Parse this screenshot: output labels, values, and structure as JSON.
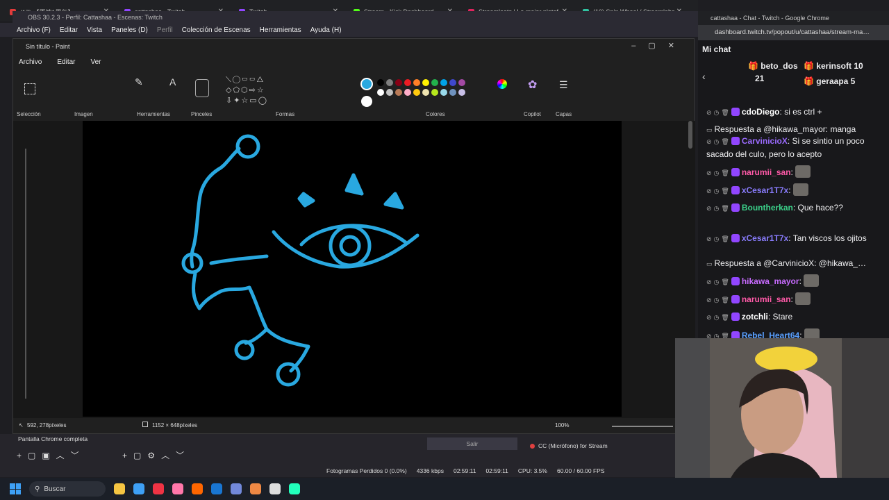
{
  "browser_tabs": [
    {
      "label": "(17) 【原神1周年】…",
      "color": "#e33b3b"
    },
    {
      "label": "cattashaa - Twitch",
      "color": "#9146ff"
    },
    {
      "label": "Twitch",
      "color": "#9146ff"
    },
    {
      "label": "Stream - Kick Dashboard",
      "color": "#53fc18"
    },
    {
      "label": "Streamloots | La mejor plataf…",
      "color": "#e0245e"
    },
    {
      "label": "(10) Spin Wheel / Streamlabs",
      "color": "#31c3a2"
    }
  ],
  "obs": {
    "title": "OBS 30.2.3 - Perfil: Cattashaa - Escenas: Twitch",
    "menu": [
      "Archivo (F)",
      "Editar",
      "Vista",
      "Paneles (D)",
      "Perfil",
      "Colección de Escenas",
      "Herramientas",
      "Ayuda (H)"
    ],
    "scene_source": "Pantalla Chrome completa",
    "audio_source": "CC (Micrófono) for Stream",
    "exit_button": "Salir",
    "status": {
      "dropped_frames": "Fotogramas Perdidos 0 (0.0%)",
      "bitrate": "4336 kbps",
      "stream_time": "02:59:11",
      "rec_time": "02:59:11",
      "cpu": "CPU: 3.5%",
      "fps": "60.00 / 60.00 FPS"
    }
  },
  "paint": {
    "title": "Sin título - Paint",
    "menu": [
      "Archivo",
      "Editar",
      "Ver"
    ],
    "groups": [
      "Selección",
      "Imagen",
      "Herramientas",
      "Pinceles",
      "Formas",
      "Colores",
      "Copilot",
      "Capas"
    ],
    "active_color": "#29a8e0",
    "palette_row1": [
      "#000000",
      "#7f7f7f",
      "#880015",
      "#ed1c24",
      "#ff7f27",
      "#fff200",
      "#22b14c",
      "#00a2e8",
      "#3f48cc",
      "#a349a4"
    ],
    "palette_row2": [
      "#ffffff",
      "#c3c3c3",
      "#b97a57",
      "#ffaec9",
      "#ffc90e",
      "#efe4b0",
      "#b5e61d",
      "#99d9ea",
      "#7092be",
      "#c8bfe7"
    ],
    "cursor_pos": "592, 278píxeles",
    "canvas_size": "1152 × 648píxeles",
    "zoom": "100%"
  },
  "chat": {
    "window_title": "cattashaa - Chat - Twitch - Google Chrome",
    "url": "dashboard.twitch.tv/popout/u/cattashaa/stream-ma…",
    "header": "Mi chat",
    "gifters": [
      {
        "name": "beto_dos",
        "count": "21"
      },
      {
        "name": "kerinsoft",
        "count": "10"
      },
      {
        "name": "geraapa",
        "count": "5"
      }
    ],
    "messages": [
      {
        "user": "cdoDiego",
        "color": "#ffffff",
        "text": "si es ctrl +"
      },
      {
        "reply": "Respuesta a @hikawa_mayor: manga"
      },
      {
        "user": "CarvinicioX",
        "color": "#9b6bff",
        "text": "Si se sintio un poco sacado del culo, pero lo acepto"
      },
      {
        "user": "narumii_san",
        "color": "#ff5aa8",
        "text": ""
      },
      {
        "user": "xCesar1T7x",
        "color": "#8a7dff",
        "text": ""
      },
      {
        "user": "Bountherkan",
        "color": "#3bd18a",
        "text": "Que hace??"
      },
      {
        "user": "xCesar1T7x",
        "color": "#8a7dff",
        "text": "Tan viscos los ojitos"
      },
      {
        "reply": "Respuesta a @CarvinicioX: @hikawa_…"
      },
      {
        "user": "hikawa_mayor",
        "color": "#c86bff",
        "text": ""
      },
      {
        "user": "narumii_san",
        "color": "#ff5aa8",
        "text": ""
      },
      {
        "user": "zotchli",
        "color": "#ffffff",
        "text": "Stare"
      },
      {
        "user": "Rebel_Heart64",
        "color": "#5aa0ff",
        "text": ""
      }
    ]
  },
  "taskbar": {
    "search": "Buscar"
  }
}
